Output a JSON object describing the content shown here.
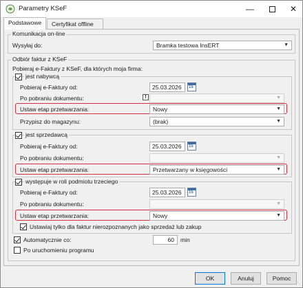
{
  "window": {
    "title": "Parametry KSeF"
  },
  "tabs": [
    {
      "label": "Podstawowe"
    },
    {
      "label": "Certyfikat offline"
    }
  ],
  "online": {
    "legend": "Komunikacja on-line",
    "send_label": "Wysyłaj do:",
    "send_value": "Bramka testowa InsERT"
  },
  "receive": {
    "legend": "Odbiór faktur z KSeF",
    "intro": "Pobieraj e-Faktury z KSeF, dla których moja firma:",
    "buyer": {
      "label": "jest nabywcą",
      "fetch_from_label": "Pobieraj e-Faktury od:",
      "fetch_from_value": "25.03.2026",
      "after_download_label": "Po pobraniu dokumentu:",
      "stage_label": "Ustaw etap przetwarzania:",
      "stage_value": "Nowy",
      "warehouse_label": "Przypisz do magazynu:",
      "warehouse_value": "(brak)"
    },
    "seller": {
      "label": "jest sprzedawcą",
      "fetch_from_label": "Pobieraj e-Faktury od:",
      "fetch_from_value": "25.03.2026",
      "after_download_label": "Po pobraniu dokumentu:",
      "stage_label": "Ustaw etap przetwarzania:",
      "stage_value": "Przetwarzany w księgowości"
    },
    "third": {
      "label": "występuje w roli podmiotu trzeciego",
      "fetch_from_label": "Pobieraj e-Faktury od:",
      "fetch_from_value": "25.03.2026",
      "after_download_label": "Po pobraniu dokumentu:",
      "stage_label": "Ustaw etap przetwarzania:",
      "stage_value": "Nowy",
      "unrecognized_label": "Ustawiaj tylko dla faktur nierozpoznanych jako sprzedaż lub zakup"
    },
    "auto_label": "Automatycznie co:",
    "auto_value": "60",
    "auto_unit": "min",
    "on_start_label": "Po uruchomieniu programu"
  },
  "buttons": {
    "ok": "OK",
    "cancel": "Anuluj",
    "help": "Pomoc"
  },
  "icons": {
    "calendar_day": "15"
  },
  "colors": {
    "highlight": "#d6303a",
    "ok_border": "#0078d7"
  }
}
